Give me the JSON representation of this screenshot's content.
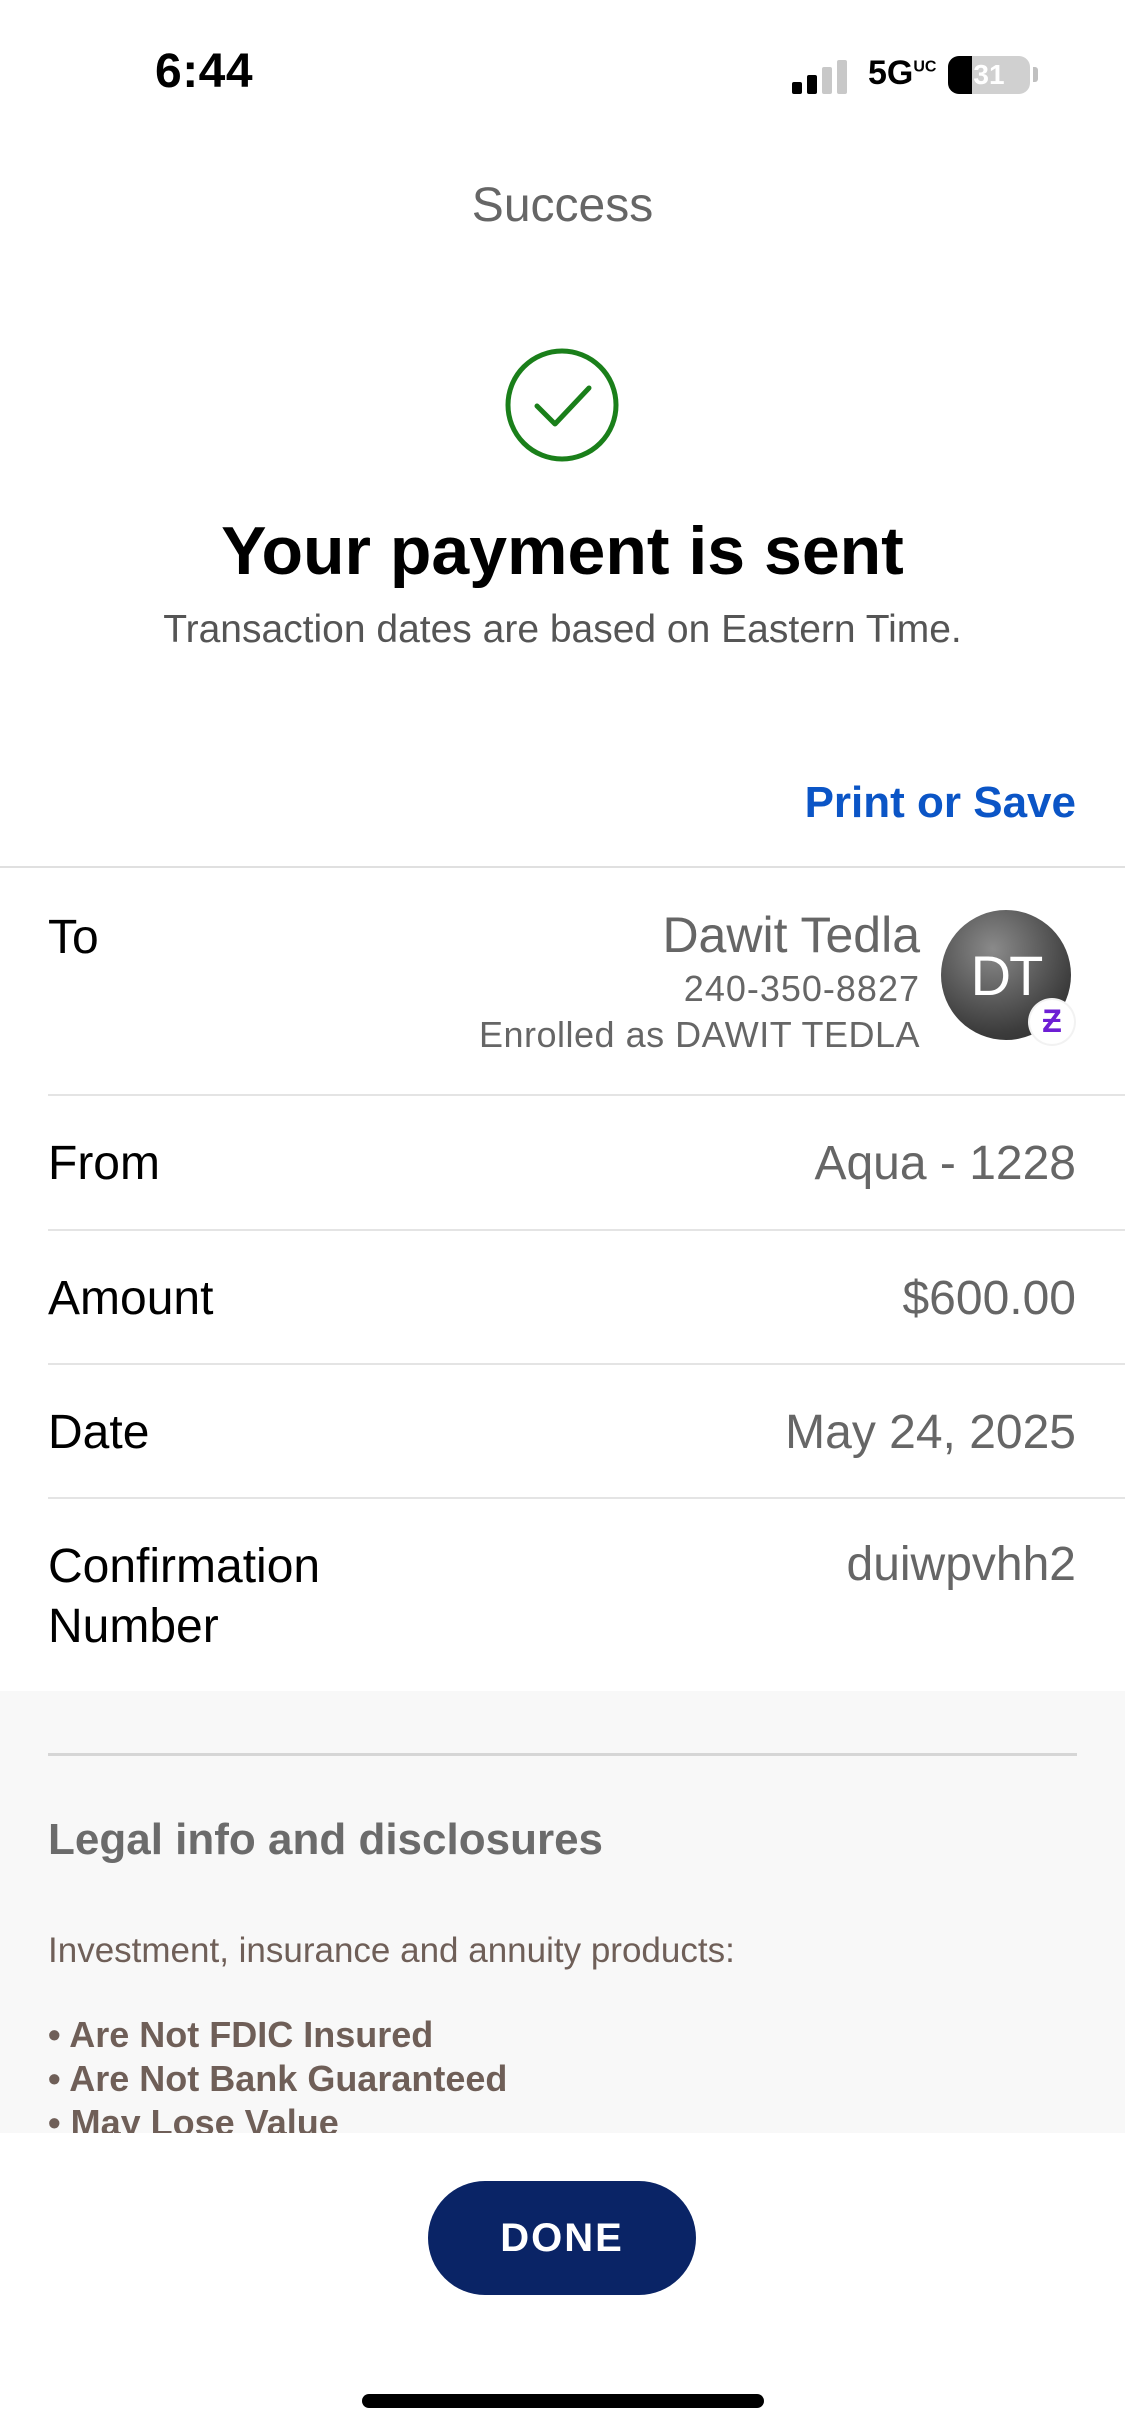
{
  "status_bar": {
    "time": "6:44",
    "network": "5G",
    "network_sup": "UC",
    "battery": "31"
  },
  "header": {
    "title": "Success"
  },
  "confirmation": {
    "icon": "checkmark-circle-icon",
    "icon_color": "#1a7f1a",
    "headline": "Your payment is sent",
    "subline": "Transaction dates are based on Eastern Time.",
    "print_save_label": "Print or Save"
  },
  "details": {
    "to": {
      "label": "To",
      "name": "Dawit Tedla",
      "phone": "240-350-8827",
      "enrolled": "Enrolled as DAWIT TEDLA",
      "avatar_initials": "DT",
      "badge": "zelle-icon",
      "badge_glyph": "Ƶ"
    },
    "from": {
      "label": "From",
      "value": "Aqua - 1228"
    },
    "amount": {
      "label": "Amount",
      "value": "$600.00"
    },
    "date": {
      "label": "Date",
      "value": "May 24, 2025"
    },
    "confirmation_number": {
      "label": "Confirmation Number",
      "value": "duiwpvhh2"
    }
  },
  "legal": {
    "title": "Legal info and disclosures",
    "intro": "Investment, insurance and annuity products:",
    "items": [
      "• Are Not FDIC Insured",
      "• Are Not Bank Guaranteed",
      "• May Lose Value"
    ]
  },
  "footer": {
    "done_label": "DONE"
  },
  "colors": {
    "accent_link": "#0b55c6",
    "done_button": "#0a2466",
    "zelle": "#6d1ed4"
  }
}
